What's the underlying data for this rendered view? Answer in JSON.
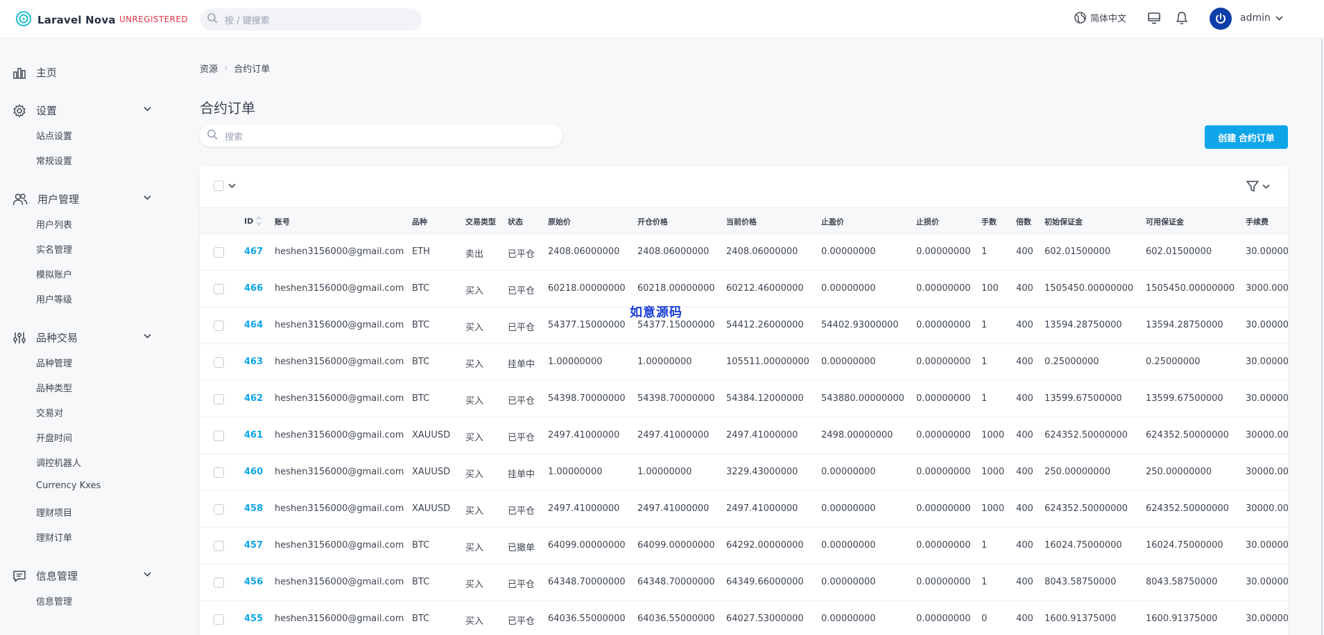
{
  "header": {
    "brand": "Laravel Nova",
    "license_badge": "UNREGISTERED",
    "search_placeholder": "按 / 键搜索",
    "language": "简体中文",
    "user": "admin"
  },
  "sidebar": {
    "home": "主页",
    "sections": [
      {
        "label": "设置",
        "icon": "gear-icon",
        "items": [
          "站点设置",
          "常规设置"
        ]
      },
      {
        "label": "用户管理",
        "icon": "users-icon",
        "items": [
          "用户列表",
          "实名管理",
          "模拟账户",
          "用户等级"
        ]
      },
      {
        "label": "品种交易",
        "icon": "sliders-icon",
        "items": [
          "品种管理",
          "品种类型",
          "交易对",
          "开盘时间",
          "调控机器人",
          "Currency Kxes",
          "理财项目",
          "理财订单"
        ]
      },
      {
        "label": "信息管理",
        "icon": "message-icon",
        "items": [
          "信息管理"
        ]
      }
    ]
  },
  "breadcrumb": {
    "root": "资源",
    "current": "合约订单"
  },
  "page": {
    "title": "合约订单",
    "search_placeholder": "搜索",
    "create_button": "创建 合约订单"
  },
  "table": {
    "columns": [
      "ID",
      "账号",
      "品种",
      "交易类型",
      "状态",
      "原始价",
      "开仓价格",
      "当前价格",
      "止盈价",
      "止损价",
      "手数",
      "倍数",
      "初始保证金",
      "可用保证金",
      "手续费"
    ],
    "rows": [
      [
        "467",
        "heshen3156000@gmail.com",
        "ETH",
        "卖出",
        "已平仓",
        "2408.06000000",
        "2408.06000000",
        "2408.06000000",
        "0.00000000",
        "0.00000000",
        "1",
        "400",
        "602.01500000",
        "602.01500000",
        "30.00000"
      ],
      [
        "466",
        "heshen3156000@gmail.com",
        "BTC",
        "买入",
        "已平仓",
        "60218.00000000",
        "60218.00000000",
        "60212.46000000",
        "0.00000000",
        "0.00000000",
        "100",
        "400",
        "1505450.00000000",
        "1505450.00000000",
        "3000.000"
      ],
      [
        "464",
        "heshen3156000@gmail.com",
        "BTC",
        "买入",
        "已平仓",
        "54377.15000000",
        "54377.15000000",
        "54412.26000000",
        "54402.93000000",
        "0.00000000",
        "1",
        "400",
        "13594.28750000",
        "13594.28750000",
        "30.00000"
      ],
      [
        "463",
        "heshen3156000@gmail.com",
        "BTC",
        "买入",
        "挂单中",
        "1.00000000",
        "1.00000000",
        "105511.00000000",
        "0.00000000",
        "0.00000000",
        "1",
        "400",
        "0.25000000",
        "0.25000000",
        "30.00000"
      ],
      [
        "462",
        "heshen3156000@gmail.com",
        "BTC",
        "买入",
        "已平仓",
        "54398.70000000",
        "54398.70000000",
        "54384.12000000",
        "543880.00000000",
        "0.00000000",
        "1",
        "400",
        "13599.67500000",
        "13599.67500000",
        "30.00000"
      ],
      [
        "461",
        "heshen3156000@gmail.com",
        "XAUUSD",
        "买入",
        "已平仓",
        "2497.41000000",
        "2497.41000000",
        "2497.41000000",
        "2498.00000000",
        "0.00000000",
        "1000",
        "400",
        "624352.50000000",
        "624352.50000000",
        "30000.00"
      ],
      [
        "460",
        "heshen3156000@gmail.com",
        "XAUUSD",
        "买入",
        "挂单中",
        "1.00000000",
        "1.00000000",
        "3229.43000000",
        "0.00000000",
        "0.00000000",
        "1000",
        "400",
        "250.00000000",
        "250.00000000",
        "30000.00"
      ],
      [
        "458",
        "heshen3156000@gmail.com",
        "XAUUSD",
        "买入",
        "已平仓",
        "2497.41000000",
        "2497.41000000",
        "2497.41000000",
        "0.00000000",
        "0.00000000",
        "1000",
        "400",
        "624352.50000000",
        "624352.50000000",
        "30000.00"
      ],
      [
        "457",
        "heshen3156000@gmail.com",
        "BTC",
        "买入",
        "已撤单",
        "64099.00000000",
        "64099.00000000",
        "64292.00000000",
        "0.00000000",
        "0.00000000",
        "1",
        "400",
        "16024.75000000",
        "16024.75000000",
        "30.00000"
      ],
      [
        "456",
        "heshen3156000@gmail.com",
        "BTC",
        "买入",
        "已平仓",
        "64348.70000000",
        "64348.70000000",
        "64349.66000000",
        "0.00000000",
        "0.00000000",
        "1",
        "400",
        "8043.58750000",
        "8043.58750000",
        "30.00000"
      ],
      [
        "455",
        "heshen3156000@gmail.com",
        "BTC",
        "买入",
        "已平仓",
        "64036.55000000",
        "64036.55000000",
        "64027.53000000",
        "0.00000000",
        "0.00000000",
        "0",
        "400",
        "1600.91375000",
        "1600.91375000",
        "30.00000"
      ]
    ]
  },
  "watermark": "如意源码",
  "colors": {
    "accent": "#0ea5e9",
    "badge": "#e0334b",
    "text": "#3d4451"
  }
}
